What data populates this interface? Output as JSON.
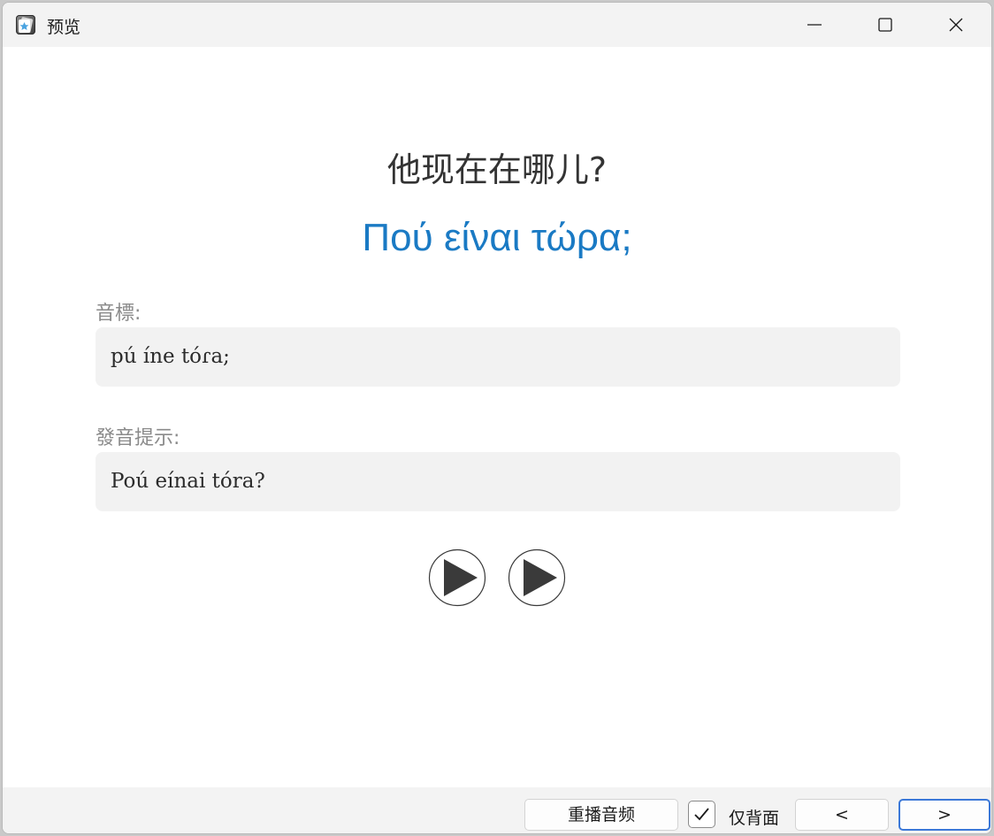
{
  "window": {
    "title": "预览"
  },
  "card": {
    "question": "他现在在哪儿?",
    "answer": "Πού είναι τώρα;",
    "phonetic_label": "音標:",
    "phonetic_value": "pú íne tóɾa;",
    "hint_label": "發音提示:",
    "hint_value": "Poú eínai tóra?",
    "audio_buttons": [
      "play-icon",
      "play-icon"
    ]
  },
  "bottom_bar": {
    "replay_label": "重播音频",
    "back_only_label": "仅背面",
    "back_only_checked": true,
    "prev_label": "<",
    "next_label": ">"
  },
  "colors": {
    "answer_text": "#1a7ac4",
    "focus_border": "#3b78d8",
    "field_background": "#f2f2f2"
  }
}
